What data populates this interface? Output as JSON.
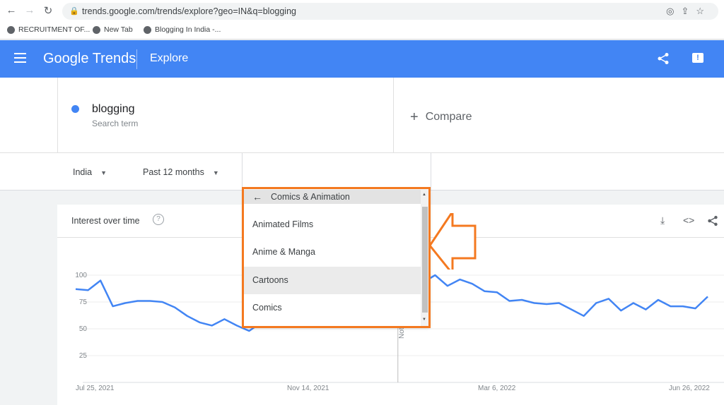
{
  "browser": {
    "url": "trends.google.com/trends/explore?geo=IN&q=blogging",
    "bookmarks": [
      "RECRUITMENT OF...",
      "New Tab",
      "Blogging In India -..."
    ]
  },
  "header": {
    "logo": "Google Trends",
    "section": "Explore"
  },
  "search": {
    "term": "blogging",
    "term_type": "Search term",
    "compare_label": "Compare"
  },
  "filters": {
    "region": "India",
    "time_range": "Past 12 months"
  },
  "category_menu": {
    "header": "Comics & Animation",
    "items": [
      {
        "label": "Animated Films",
        "highlighted": false
      },
      {
        "label": "Anime & Manga",
        "highlighted": false
      },
      {
        "label": "Cartoons",
        "highlighted": true
      },
      {
        "label": "Comics",
        "highlighted": false
      }
    ]
  },
  "chart_card": {
    "title": "Interest over time",
    "note_label": "Note"
  },
  "chart_data": {
    "type": "line",
    "ylim": [
      0,
      100
    ],
    "y_ticks": [
      100,
      75,
      50,
      25
    ],
    "x_ticks": [
      "Jul 25, 2021",
      "Nov 14, 2021",
      "Mar 6, 2022",
      "Jun 26, 2022"
    ],
    "series": [
      {
        "color": "#4285f4",
        "values": [
          87,
          86,
          95,
          71,
          74,
          76,
          76,
          75,
          70,
          62,
          56,
          53,
          59,
          53,
          48,
          56,
          57,
          56,
          56,
          56,
          57,
          58,
          60,
          62,
          84,
          88,
          90,
          95,
          93,
          100,
          90,
          96,
          92,
          85,
          84,
          76,
          77,
          74,
          73,
          74,
          68,
          62,
          74,
          78,
          67,
          74,
          68,
          77,
          71,
          71,
          69,
          80
        ]
      }
    ]
  },
  "colors": {
    "brand": "#4285f4",
    "annotation": "#f47920"
  }
}
